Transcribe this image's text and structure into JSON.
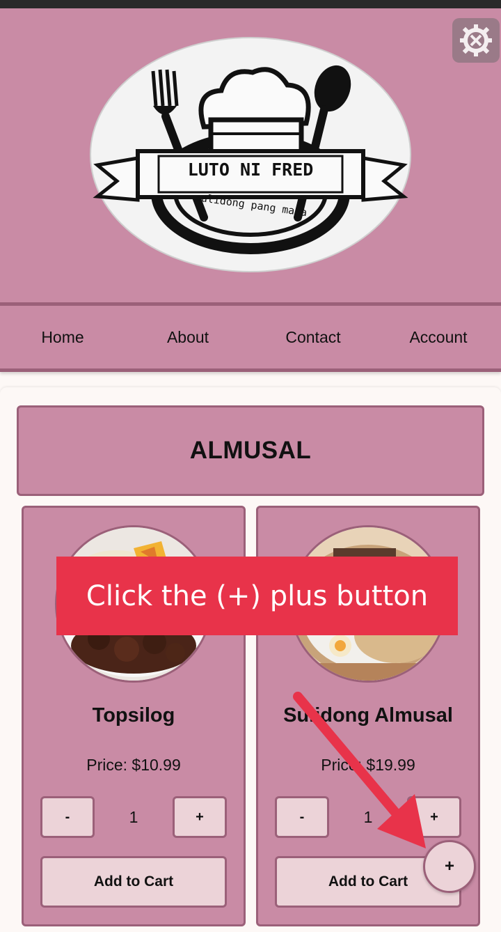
{
  "header": {
    "logo": {
      "brand_name": "LUTO NI FRED",
      "tagline": "sulidong pang masa",
      "icon": "chef-hat-fork-spoon-logo"
    },
    "settings_icon": "gear-wrench-icon"
  },
  "nav": {
    "items": [
      {
        "label": "Home"
      },
      {
        "label": "About"
      },
      {
        "label": "Contact"
      },
      {
        "label": "Account"
      }
    ]
  },
  "category": {
    "title": "ALMUSAL"
  },
  "products": [
    {
      "name": "Topsilog",
      "price": "Price: $10.99",
      "minus_label": "-",
      "quantity": "1",
      "plus_label": "+",
      "cart_label": "Add to Cart"
    },
    {
      "name": "Sulidong Almusal",
      "price": "Price: $19.99",
      "minus_label": "-",
      "quantity": "1",
      "plus_label": "+",
      "cart_label": "Add to Cart"
    }
  ],
  "overlay": {
    "hint": "Click the (+) plus button",
    "fab_label": "+",
    "arrow_color": "#e8334a"
  },
  "colors": {
    "primary": "#c98ba5",
    "border": "#9b6079",
    "button": "#ecd3d8",
    "background": "#fdf8f6",
    "accent": "#e8334a"
  }
}
